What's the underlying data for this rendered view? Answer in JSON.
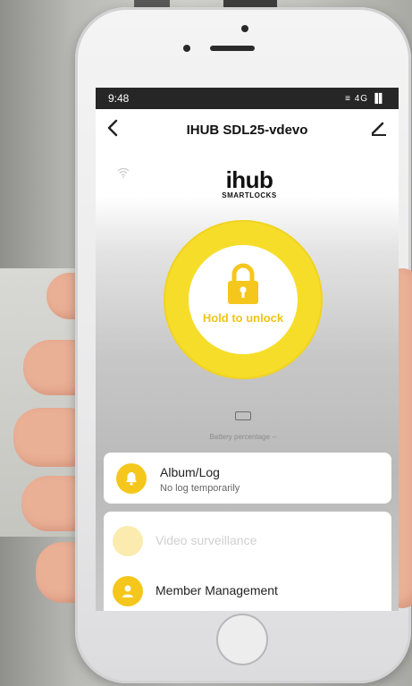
{
  "status_bar": {
    "time": "9:48",
    "icons": "≡ 4G ▐▌"
  },
  "header": {
    "title": "IHUB SDL25-vdevo",
    "back_icon": "chevron-left-icon",
    "edit_icon": "pencil-icon"
  },
  "brand": {
    "logo_main": "ihub",
    "logo_sub": "SMARTLOCKS"
  },
  "lock": {
    "label": "Hold to unlock",
    "accent": "#f5c71c"
  },
  "battery": {
    "label": "Battery percentage --"
  },
  "menu": [
    {
      "title": "Album/Log",
      "subtitle": "No log temporarily",
      "icon": "bell-icon"
    },
    {
      "title": "Video surveillance",
      "icon": "video-icon",
      "enabled": false
    },
    {
      "title": "Member Management",
      "icon": "person-icon"
    }
  ]
}
